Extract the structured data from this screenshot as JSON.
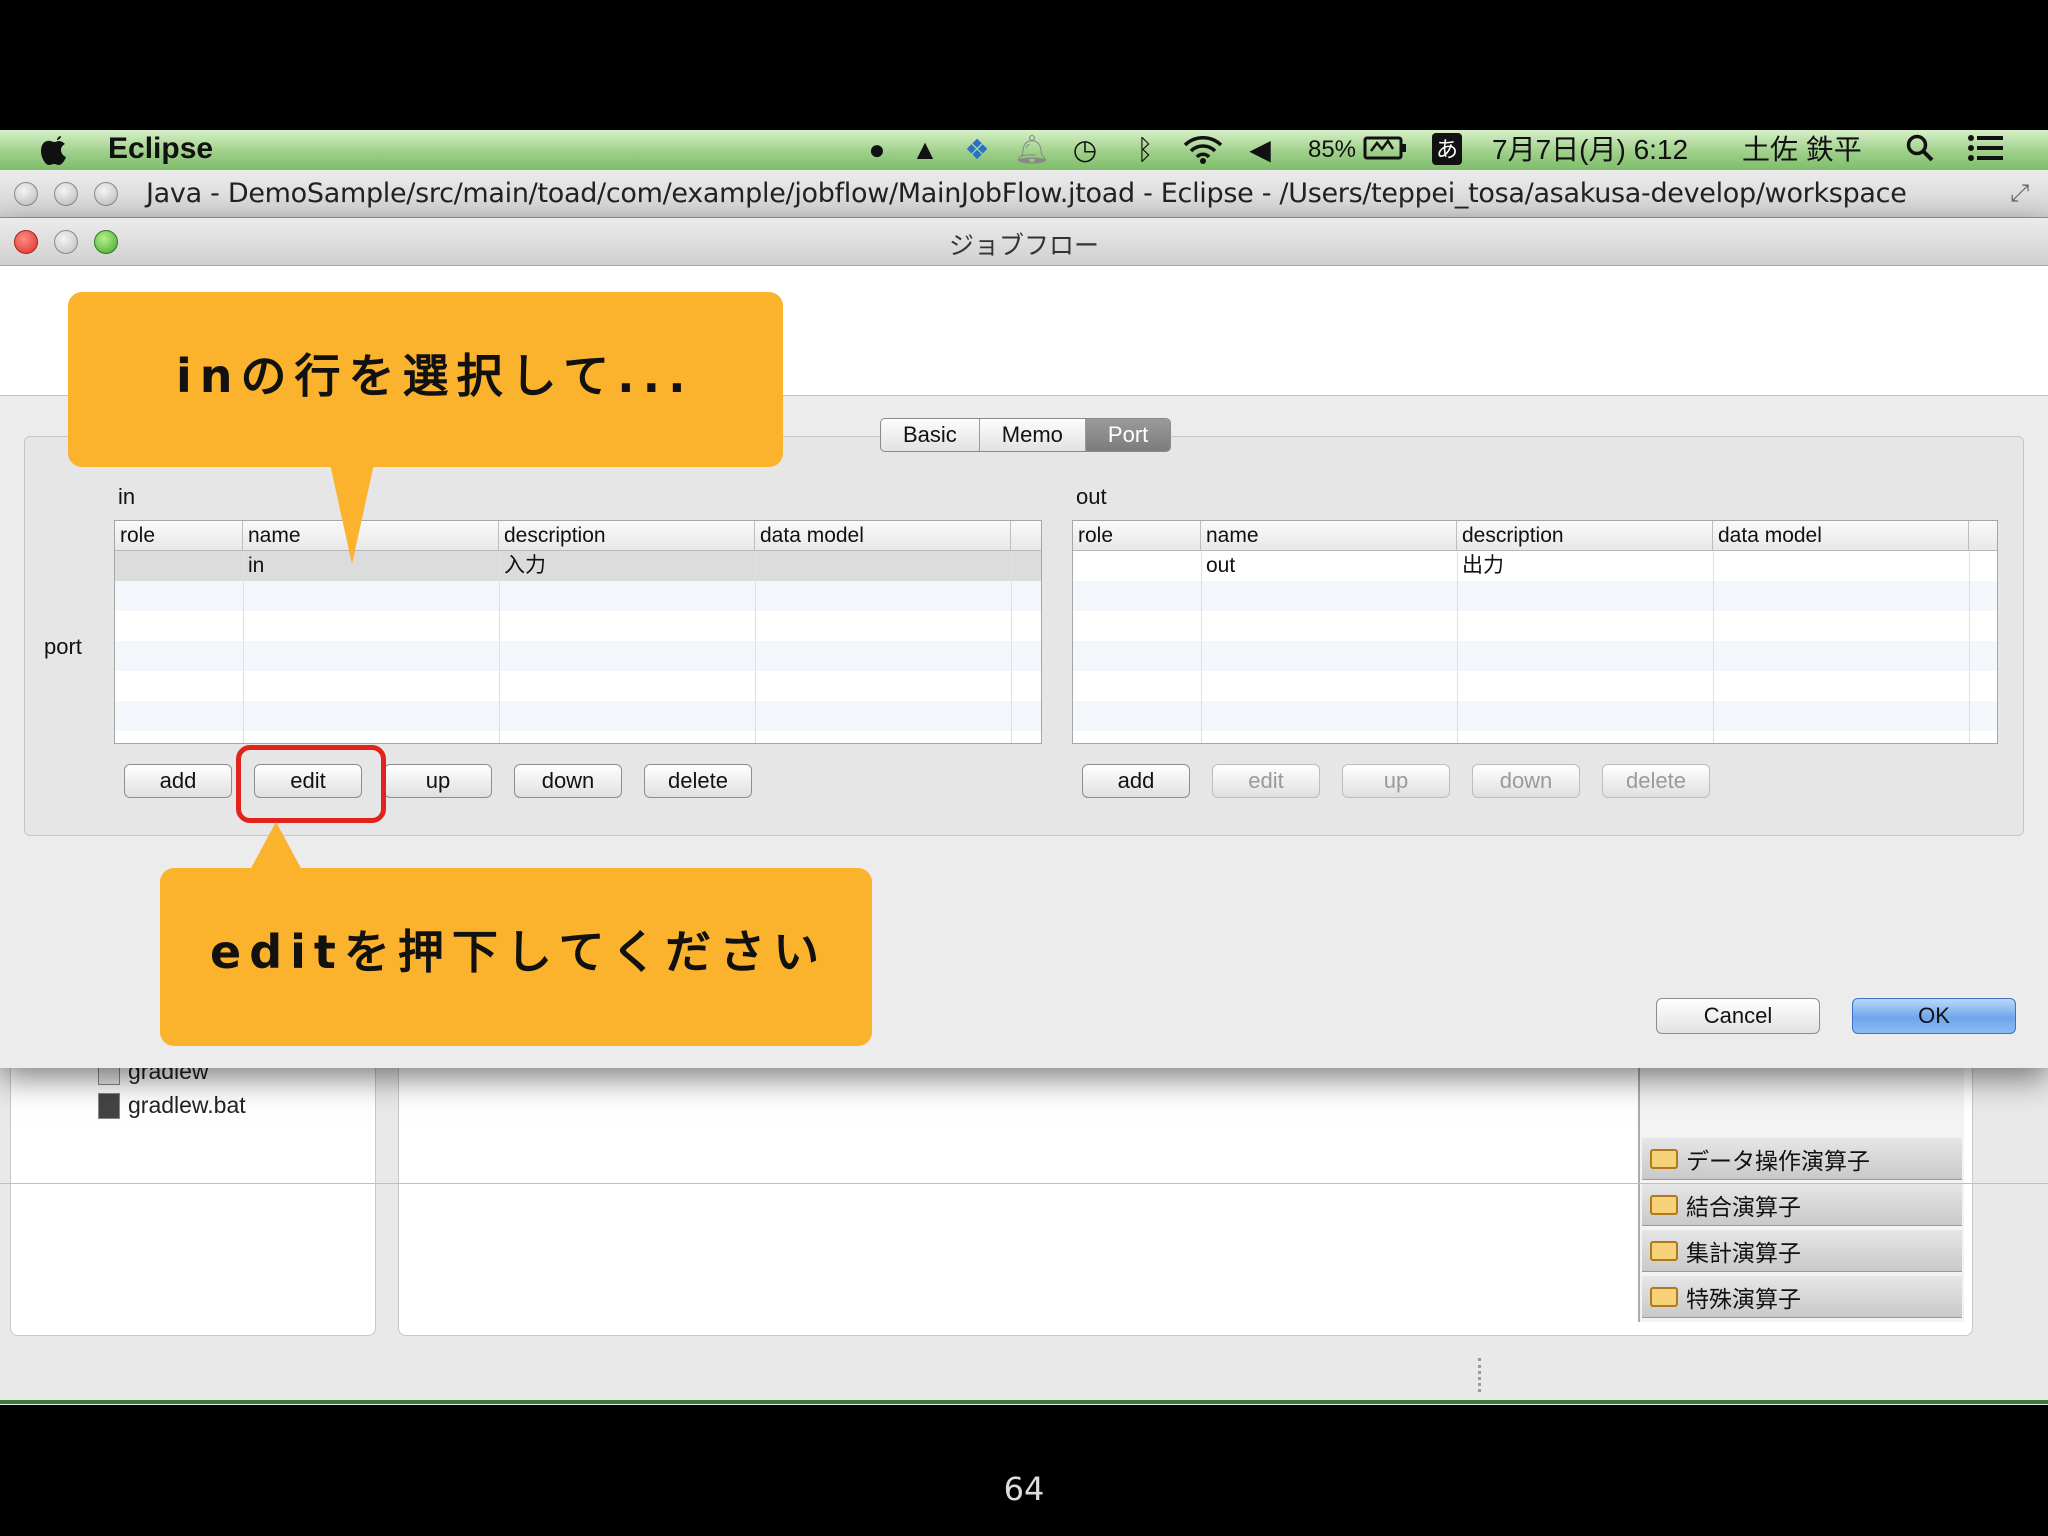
{
  "menubar": {
    "app_name": "Eclipse",
    "battery": "85%",
    "ime": "あ",
    "datetime": "7月7日(月) 6:12",
    "user": "土佐 鉄平"
  },
  "eclipse_window": {
    "title": "Java - DemoSample/src/main/toad/com/example/jobflow/MainJobFlow.jtoad - Eclipse - /Users/teppei_tosa/asakusa-develop/workspace"
  },
  "background": {
    "files": [
      "gradlew",
      "gradlew.bat"
    ],
    "palette": [
      "データ操作演算子",
      "結合演算子",
      "集計演算子",
      "特殊演算子"
    ]
  },
  "dialog": {
    "title": "ジョブフロー",
    "tabs": [
      "Basic",
      "Memo",
      "Port"
    ],
    "selected_tab": "Port",
    "port_label": "port",
    "in": {
      "label": "in",
      "columns": [
        "role",
        "name",
        "description",
        "data model"
      ],
      "rows": [
        {
          "role": "",
          "name": "in",
          "description": "入力",
          "data_model": ""
        }
      ],
      "buttons": [
        "add",
        "edit",
        "up",
        "down",
        "delete"
      ]
    },
    "out": {
      "label": "out",
      "columns": [
        "role",
        "name",
        "description",
        "data model"
      ],
      "rows": [
        {
          "role": "",
          "name": "out",
          "description": "出力",
          "data_model": ""
        }
      ],
      "buttons": [
        "add",
        "edit",
        "up",
        "down",
        "delete"
      ]
    },
    "cancel_label": "Cancel",
    "ok_label": "OK"
  },
  "callouts": {
    "select_row": "inの行を選択して...",
    "press_edit": "editを押下してください"
  },
  "colors": {
    "callout": "#fbb22c",
    "highlight": "#e2231a"
  },
  "page_number": "64"
}
